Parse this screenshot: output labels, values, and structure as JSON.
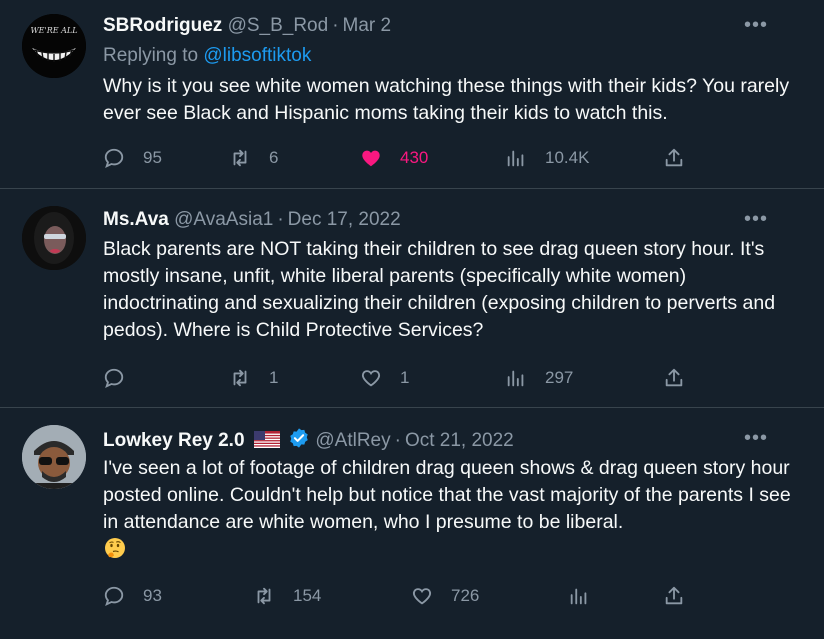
{
  "tweets": [
    {
      "name": "SBRodriguez",
      "handle": "@S_B_Rod",
      "date": "Mar 2",
      "reply_to_label": "Replying to",
      "reply_to_handle": "@libsoftiktok",
      "text": "Why is it you see white women watching these things with their kids? You rarely ever see Black and Hispanic moms taking their kids to watch this.",
      "avatar_text": "WE'RE ALL MAD HERE",
      "stats": {
        "replies": "95",
        "retweets": "6",
        "likes": "430",
        "views": "10.4K"
      },
      "liked": true
    },
    {
      "name": "Ms.Ava",
      "handle": "@AvaAsia1",
      "date": "Dec 17, 2022",
      "text": "Black parents are NOT taking their children to see drag queen story hour. It's mostly insane, unfit, white liberal parents (specifically white women) indoctrinating and sexualizing their children (exposing children to perverts and pedos). Where is Child Protective Services?",
      "stats": {
        "replies": "",
        "retweets": "1",
        "likes": "1",
        "views": "297"
      },
      "liked": false
    },
    {
      "name": "Lowkey Rey 2.0",
      "handle": "@AtlRey",
      "date": "Oct 21, 2022",
      "text": "I've seen a lot of footage of children drag queen shows & drag queen story hour posted online. Couldn't help but notice that the vast majority of the parents I see in attendance are white women, who I presume to be liberal.",
      "stats": {
        "replies": "93",
        "retweets": "154",
        "likes": "726",
        "views": ""
      },
      "liked": false,
      "verified": true
    }
  ],
  "separator": "·",
  "more_label": "•••",
  "colors": {
    "background": "#15202b",
    "text": "#f7f9f9",
    "muted": "#8b98a5",
    "accent": "#1d9bf0",
    "like": "#f91880",
    "border": "#38444d"
  },
  "icons": [
    "reply-icon",
    "retweet-icon",
    "heart-icon",
    "views-icon",
    "share-icon",
    "verified-badge-icon",
    "us-flag-icon",
    "thinking-face-icon"
  ]
}
